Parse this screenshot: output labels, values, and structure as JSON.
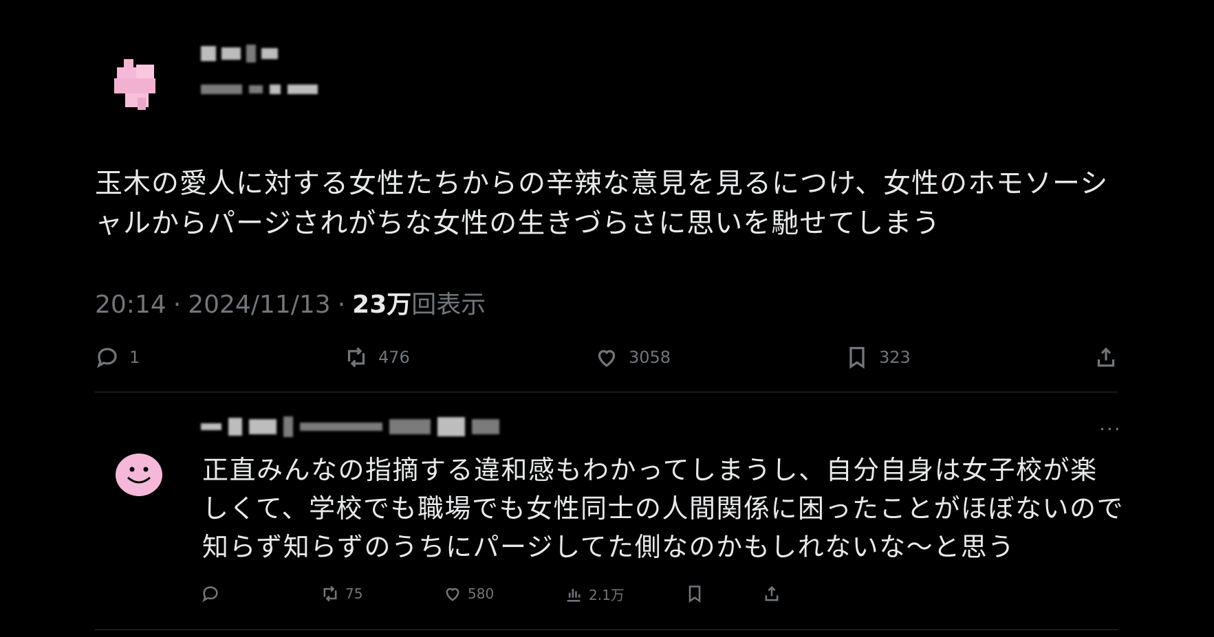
{
  "tweet": {
    "text": "玉木の愛人に対する女性たちからの辛辣な意見を見るにつけ、女性のホモソーシャルからパージされがちな女性の生きづらさに思いを馳せてしまう",
    "time": "20:14",
    "date": "2024/11/13",
    "views_number": "23万",
    "views_label": "回表示",
    "separator": "·",
    "actions": {
      "reply_count": "1",
      "retweet_count": "476",
      "like_count": "3058",
      "bookmark_count": "323"
    }
  },
  "reply": {
    "more_label": "···",
    "text": "正直みんなの指摘する違和感もわかってしまうし、自分自身は女子校が楽しくて、学校でも職場でも女性同士の人間関係に困ったことがほぼないので知らず知らずのうちにパージしてた側なのかもしれないな〜と思う",
    "actions": {
      "retweet_count": "75",
      "like_count": "580",
      "views_count": "2.1万"
    }
  },
  "colors": {
    "background": "#000000",
    "text": "#e7e9ea",
    "muted": "#71767b",
    "divider": "#2f3336",
    "avatar_pink": "#f6b8d8"
  },
  "icons": [
    "reply-icon",
    "retweet-icon",
    "like-icon",
    "bookmark-icon",
    "share-icon",
    "analytics-icon",
    "more-icon"
  ]
}
